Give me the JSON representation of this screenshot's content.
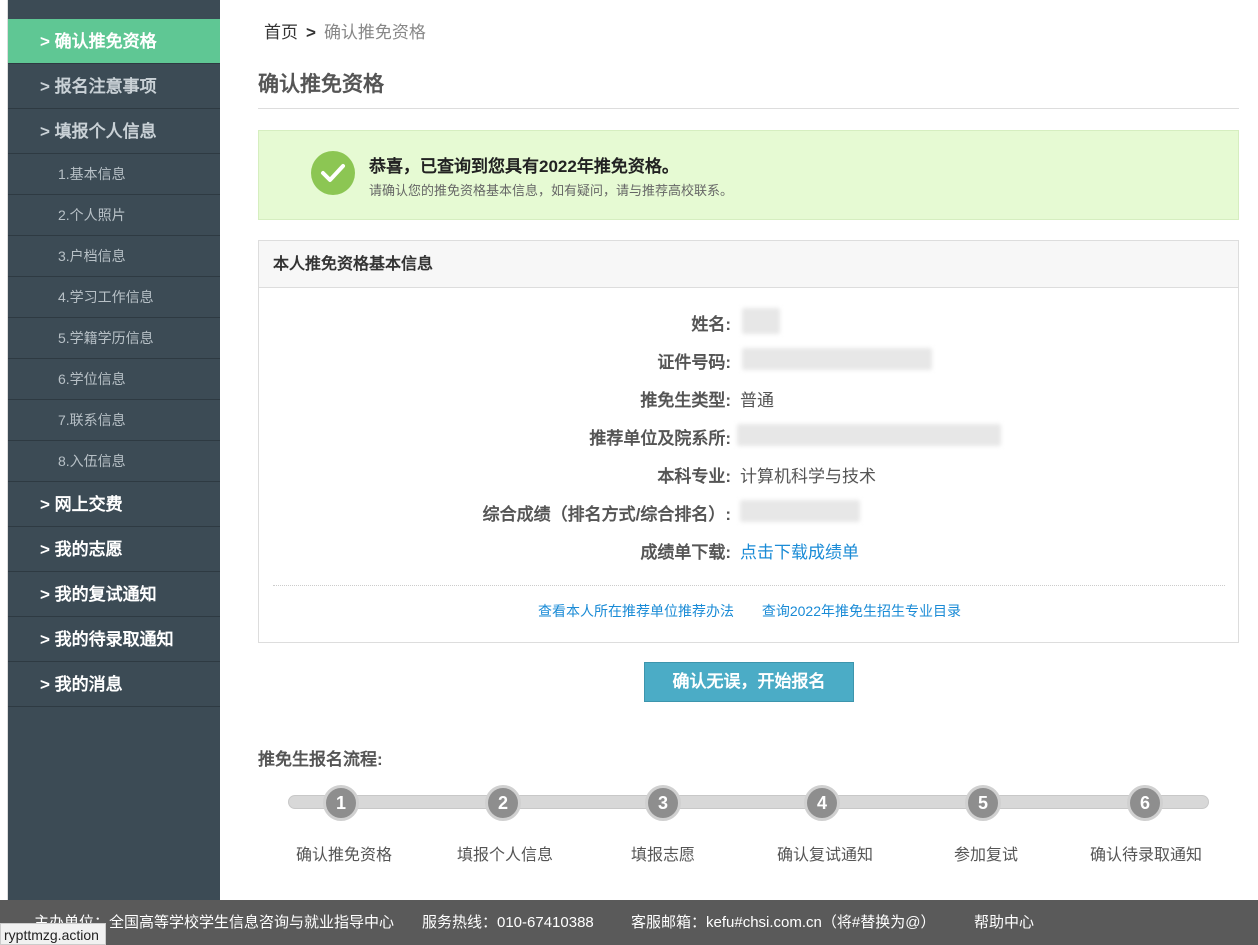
{
  "sidebar": {
    "items": [
      {
        "label": "> 确认推免资格"
      },
      {
        "label": "> 报名注意事项"
      },
      {
        "label": "> 填报个人信息"
      }
    ],
    "sub_items": [
      {
        "label": "1.基本信息"
      },
      {
        "label": "2.个人照片"
      },
      {
        "label": "3.户档信息"
      },
      {
        "label": "4.学习工作信息"
      },
      {
        "label": "5.学籍学历信息"
      },
      {
        "label": "6.学位信息"
      },
      {
        "label": "7.联系信息"
      },
      {
        "label": "8.入伍信息"
      }
    ],
    "bottom_items": [
      {
        "label": "> 网上交费"
      },
      {
        "label": "> 我的志愿"
      },
      {
        "label": "> 我的复试通知"
      },
      {
        "label": "> 我的待录取通知"
      },
      {
        "label": "> 我的消息"
      }
    ]
  },
  "breadcrumb": {
    "home": "首页",
    "separator": ">",
    "current": "确认推免资格"
  },
  "page_title": "确认推免资格",
  "success": {
    "title": "恭喜，已查询到您具有2022年推免资格。",
    "subtitle": "请确认您的推免资格基本信息，如有疑问，请与推荐高校联系。"
  },
  "panel": {
    "title": "本人推免资格基本信息",
    "rows": [
      {
        "label": "姓名:",
        "value": ""
      },
      {
        "label": "证件号码:",
        "value": ""
      },
      {
        "label": "推免生类型:",
        "value": "普通"
      },
      {
        "label": "推荐单位及院系所:",
        "value": ""
      },
      {
        "label": "本科专业:",
        "value": "计算机科学与技术"
      },
      {
        "label": "综合成绩（排名方式/综合排名）:",
        "value": ""
      },
      {
        "label": "成绩单下载:",
        "value": "点击下载成绩单"
      }
    ],
    "links": [
      "查看本人所在推荐单位推荐办法",
      "查询2022年推免生招生专业目录"
    ]
  },
  "confirm_button": "确认无误，开始报名",
  "flow": {
    "title": "推免生报名流程:",
    "steps": [
      {
        "num": "1",
        "label": "确认推免资格"
      },
      {
        "num": "2",
        "label": "填报个人信息"
      },
      {
        "num": "3",
        "label": "填报志愿"
      },
      {
        "num": "4",
        "label": "确认复试通知"
      },
      {
        "num": "5",
        "label": "参加复试"
      },
      {
        "num": "6",
        "label": "确认待录取通知"
      }
    ]
  },
  "footer": {
    "home": "主办单位：全国高等学校学生信息咨询与就业指导中心",
    "hotline": "服务热线：010-67410388",
    "email": "客服邮箱：kefu#chsi.com.cn（将#替换为@）",
    "help": "帮助中心"
  },
  "status_url": "rypttmzg.action",
  "colors": {
    "sidebar": "#3c4b55",
    "active": "#5fc794",
    "button": "#4bacc6",
    "link": "#1a8bd6",
    "success_bg": "#e6fad3"
  }
}
